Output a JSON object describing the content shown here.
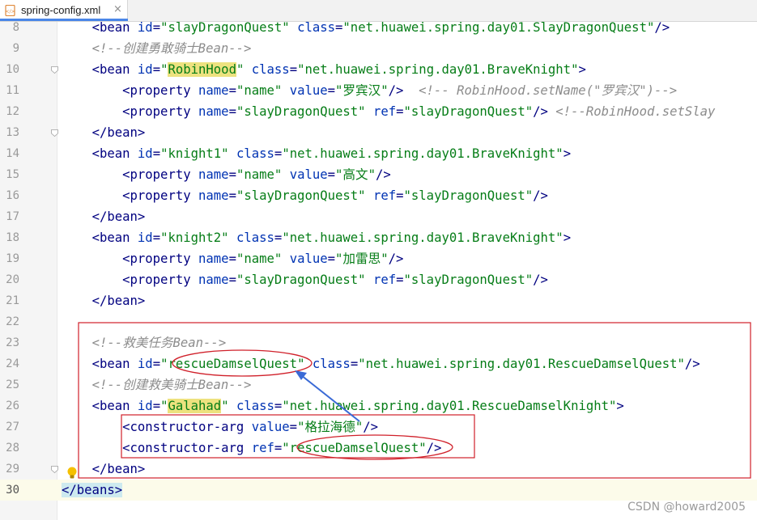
{
  "tab": {
    "filename": "spring-config.xml",
    "close_glyph": "×",
    "icon": "xml-file-icon"
  },
  "lines": [
    {
      "n": "8",
      "tokens": [
        {
          "t": "    "
        },
        {
          "t": "<bean ",
          "c": "tg"
        },
        {
          "t": "id",
          "c": "an"
        },
        {
          "t": "=",
          "c": "tg"
        },
        {
          "t": "\"slayDragonQuest\"",
          "c": "av"
        },
        {
          "t": " "
        },
        {
          "t": "class",
          "c": "an"
        },
        {
          "t": "=",
          "c": "tg"
        },
        {
          "t": "\"net.huawei.spring.day01.SlayDragonQuest\"",
          "c": "av"
        },
        {
          "t": "/>",
          "c": "tg"
        }
      ]
    },
    {
      "n": "9",
      "tokens": [
        {
          "t": "    "
        },
        {
          "t": "<!--创建勇敢骑士Bean-->",
          "c": "cm"
        }
      ]
    },
    {
      "n": "10",
      "tokens": [
        {
          "t": "    "
        },
        {
          "t": "<bean ",
          "c": "tg"
        },
        {
          "t": "id",
          "c": "an"
        },
        {
          "t": "=",
          "c": "tg"
        },
        {
          "t": "\"",
          "c": "av"
        },
        {
          "t": "RobinHood",
          "c": "av",
          "hl": true
        },
        {
          "t": "\"",
          "c": "av"
        },
        {
          "t": " "
        },
        {
          "t": "class",
          "c": "an"
        },
        {
          "t": "=",
          "c": "tg"
        },
        {
          "t": "\"net.huawei.spring.day01.BraveKnight\"",
          "c": "av"
        },
        {
          "t": ">",
          "c": "tg"
        }
      ]
    },
    {
      "n": "11",
      "tokens": [
        {
          "t": "        "
        },
        {
          "t": "<property ",
          "c": "tg"
        },
        {
          "t": "name",
          "c": "an"
        },
        {
          "t": "=",
          "c": "tg"
        },
        {
          "t": "\"name\"",
          "c": "av"
        },
        {
          "t": " "
        },
        {
          "t": "value",
          "c": "an"
        },
        {
          "t": "=",
          "c": "tg"
        },
        {
          "t": "\"罗宾汉\"",
          "c": "av"
        },
        {
          "t": "/>",
          "c": "tg"
        },
        {
          "t": "  "
        },
        {
          "t": "<!-- RobinHood.setName(\"罗宾汉\")-->",
          "c": "cm"
        }
      ]
    },
    {
      "n": "12",
      "tokens": [
        {
          "t": "        "
        },
        {
          "t": "<property ",
          "c": "tg"
        },
        {
          "t": "name",
          "c": "an"
        },
        {
          "t": "=",
          "c": "tg"
        },
        {
          "t": "\"slayDragonQuest\"",
          "c": "av"
        },
        {
          "t": " "
        },
        {
          "t": "ref",
          "c": "an"
        },
        {
          "t": "=",
          "c": "tg"
        },
        {
          "t": "\"slayDragonQuest\"",
          "c": "av"
        },
        {
          "t": "/>",
          "c": "tg"
        },
        {
          "t": " "
        },
        {
          "t": "<!--RobinHood.setSlay",
          "c": "cm"
        }
      ]
    },
    {
      "n": "13",
      "tokens": [
        {
          "t": "    "
        },
        {
          "t": "</bean>",
          "c": "tg"
        }
      ]
    },
    {
      "n": "14",
      "tokens": [
        {
          "t": "    "
        },
        {
          "t": "<bean ",
          "c": "tg"
        },
        {
          "t": "id",
          "c": "an"
        },
        {
          "t": "=",
          "c": "tg"
        },
        {
          "t": "\"knight1\"",
          "c": "av"
        },
        {
          "t": " "
        },
        {
          "t": "class",
          "c": "an"
        },
        {
          "t": "=",
          "c": "tg"
        },
        {
          "t": "\"net.huawei.spring.day01.BraveKnight\"",
          "c": "av"
        },
        {
          "t": ">",
          "c": "tg"
        }
      ]
    },
    {
      "n": "15",
      "tokens": [
        {
          "t": "        "
        },
        {
          "t": "<property ",
          "c": "tg"
        },
        {
          "t": "name",
          "c": "an"
        },
        {
          "t": "=",
          "c": "tg"
        },
        {
          "t": "\"name\"",
          "c": "av"
        },
        {
          "t": " "
        },
        {
          "t": "value",
          "c": "an"
        },
        {
          "t": "=",
          "c": "tg"
        },
        {
          "t": "\"高文\"",
          "c": "av"
        },
        {
          "t": "/>",
          "c": "tg"
        }
      ]
    },
    {
      "n": "16",
      "tokens": [
        {
          "t": "        "
        },
        {
          "t": "<property ",
          "c": "tg"
        },
        {
          "t": "name",
          "c": "an"
        },
        {
          "t": "=",
          "c": "tg"
        },
        {
          "t": "\"slayDragonQuest\"",
          "c": "av"
        },
        {
          "t": " "
        },
        {
          "t": "ref",
          "c": "an"
        },
        {
          "t": "=",
          "c": "tg"
        },
        {
          "t": "\"slayDragonQuest\"",
          "c": "av"
        },
        {
          "t": "/>",
          "c": "tg"
        }
      ]
    },
    {
      "n": "17",
      "tokens": [
        {
          "t": "    "
        },
        {
          "t": "</bean>",
          "c": "tg"
        }
      ]
    },
    {
      "n": "18",
      "tokens": [
        {
          "t": "    "
        },
        {
          "t": "<bean ",
          "c": "tg"
        },
        {
          "t": "id",
          "c": "an"
        },
        {
          "t": "=",
          "c": "tg"
        },
        {
          "t": "\"knight2\"",
          "c": "av"
        },
        {
          "t": " "
        },
        {
          "t": "class",
          "c": "an"
        },
        {
          "t": "=",
          "c": "tg"
        },
        {
          "t": "\"net.huawei.spring.day01.BraveKnight\"",
          "c": "av"
        },
        {
          "t": ">",
          "c": "tg"
        }
      ]
    },
    {
      "n": "19",
      "tokens": [
        {
          "t": "        "
        },
        {
          "t": "<property ",
          "c": "tg"
        },
        {
          "t": "name",
          "c": "an"
        },
        {
          "t": "=",
          "c": "tg"
        },
        {
          "t": "\"name\"",
          "c": "av"
        },
        {
          "t": " "
        },
        {
          "t": "value",
          "c": "an"
        },
        {
          "t": "=",
          "c": "tg"
        },
        {
          "t": "\"加雷思\"",
          "c": "av"
        },
        {
          "t": "/>",
          "c": "tg"
        }
      ]
    },
    {
      "n": "20",
      "tokens": [
        {
          "t": "        "
        },
        {
          "t": "<property ",
          "c": "tg"
        },
        {
          "t": "name",
          "c": "an"
        },
        {
          "t": "=",
          "c": "tg"
        },
        {
          "t": "\"slayDragonQuest\"",
          "c": "av"
        },
        {
          "t": " "
        },
        {
          "t": "ref",
          "c": "an"
        },
        {
          "t": "=",
          "c": "tg"
        },
        {
          "t": "\"slayDragonQuest\"",
          "c": "av"
        },
        {
          "t": "/>",
          "c": "tg"
        }
      ]
    },
    {
      "n": "21",
      "tokens": [
        {
          "t": "    "
        },
        {
          "t": "</bean>",
          "c": "tg"
        }
      ]
    },
    {
      "n": "22",
      "tokens": []
    },
    {
      "n": "23",
      "tokens": [
        {
          "t": "    "
        },
        {
          "t": "<!--救美任务Bean-->",
          "c": "cm"
        }
      ]
    },
    {
      "n": "24",
      "tokens": [
        {
          "t": "    "
        },
        {
          "t": "<bean ",
          "c": "tg"
        },
        {
          "t": "id",
          "c": "an"
        },
        {
          "t": "=",
          "c": "tg"
        },
        {
          "t": "\"rescueDamselQuest\"",
          "c": "av"
        },
        {
          "t": " "
        },
        {
          "t": "class",
          "c": "an"
        },
        {
          "t": "=",
          "c": "tg"
        },
        {
          "t": "\"net.huawei.spring.day01.RescueDamselQuest\"",
          "c": "av"
        },
        {
          "t": "/>",
          "c": "tg"
        }
      ]
    },
    {
      "n": "25",
      "tokens": [
        {
          "t": "    "
        },
        {
          "t": "<!--创建救美骑士Bean-->",
          "c": "cm"
        }
      ]
    },
    {
      "n": "26",
      "tokens": [
        {
          "t": "    "
        },
        {
          "t": "<bean ",
          "c": "tg"
        },
        {
          "t": "id",
          "c": "an"
        },
        {
          "t": "=",
          "c": "tg"
        },
        {
          "t": "\"",
          "c": "av"
        },
        {
          "t": "Galahad",
          "c": "av",
          "hl": true
        },
        {
          "t": "\"",
          "c": "av"
        },
        {
          "t": " "
        },
        {
          "t": "class",
          "c": "an"
        },
        {
          "t": "=",
          "c": "tg"
        },
        {
          "t": "\"net.huawei.spring.day01.RescueDamselKnight\"",
          "c": "av"
        },
        {
          "t": ">",
          "c": "tg"
        }
      ]
    },
    {
      "n": "27",
      "tokens": [
        {
          "t": "        "
        },
        {
          "t": "<constructor-arg ",
          "c": "tg"
        },
        {
          "t": "value",
          "c": "an"
        },
        {
          "t": "=",
          "c": "tg"
        },
        {
          "t": "\"格拉海德\"",
          "c": "av"
        },
        {
          "t": "/>",
          "c": "tg"
        }
      ]
    },
    {
      "n": "28",
      "tokens": [
        {
          "t": "        "
        },
        {
          "t": "<constructor-arg ",
          "c": "tg"
        },
        {
          "t": "ref",
          "c": "an"
        },
        {
          "t": "=",
          "c": "tg"
        },
        {
          "t": "\"rescueDamselQuest\"",
          "c": "av"
        },
        {
          "t": "/>",
          "c": "tg"
        }
      ]
    },
    {
      "n": "29",
      "tokens": [
        {
          "t": "    "
        },
        {
          "t": "</bean>",
          "c": "tg"
        }
      ]
    },
    {
      "n": "30",
      "tokens": [
        {
          "t": "</beans>",
          "c": "tg",
          "cur": true
        }
      ]
    }
  ],
  "fold_markers": [
    "10",
    "13",
    "29"
  ],
  "watermark": "CSDN @howard2005",
  "colors": {
    "tag": "#000080",
    "attr_name": "#0033b3",
    "attr_value": "#067d17",
    "comment": "#8c8c8c",
    "highlight": "#ede27f",
    "annotation_red": "#d0202a",
    "annotation_blue": "#3a6ad6"
  }
}
